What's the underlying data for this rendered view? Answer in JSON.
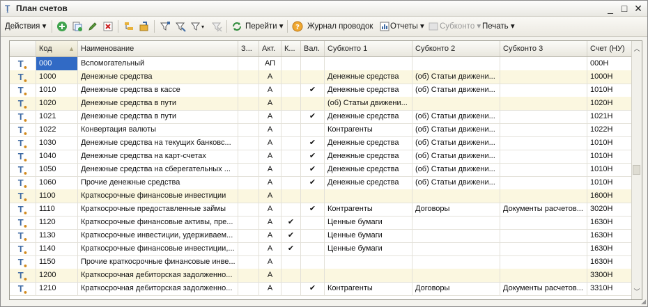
{
  "window": {
    "title": "План счетов"
  },
  "window_controls": {
    "minimize": "_",
    "maximize": "□",
    "close": "✕"
  },
  "toolbar": {
    "actions": "Действия",
    "goto": "Перейти",
    "journal": "Журнал проводок",
    "reports": "Отчеты",
    "subconto": "Субконто",
    "print": "Печать"
  },
  "columns": {
    "code": "Код",
    "name": "Наименование",
    "z": "З...",
    "act": "Акт.",
    "k": "К...",
    "val": "Вал.",
    "sub1": "Субконто 1",
    "sub2": "Субконто 2",
    "sub3": "Субконто 3",
    "nu": "Счет (НУ)"
  },
  "rows": [
    {
      "code": "000",
      "name": "Вспомогательный",
      "z": "",
      "act": "АП",
      "k": "",
      "val": "",
      "sub1": "",
      "sub2": "",
      "sub3": "",
      "nu": "000Н",
      "grp": false
    },
    {
      "code": "1000",
      "name": "Денежные средства",
      "z": "",
      "act": "А",
      "k": "",
      "val": "",
      "sub1": "Денежные средства",
      "sub2": "(об) Статьи движени...",
      "sub3": "",
      "nu": "1000Н",
      "grp": true
    },
    {
      "code": "1010",
      "name": "Денежные средства в кассе",
      "z": "",
      "act": "А",
      "k": "",
      "val": "✔",
      "sub1": "Денежные средства",
      "sub2": "(об) Статьи движени...",
      "sub3": "",
      "nu": "1010Н",
      "grp": false
    },
    {
      "code": "1020",
      "name": "Денежные средства в пути",
      "z": "",
      "act": "А",
      "k": "",
      "val": "",
      "sub1": "(об) Статьи движени...",
      "sub2": "",
      "sub3": "",
      "nu": "1020Н",
      "grp": true
    },
    {
      "code": "1021",
      "name": "Денежные средства в пути",
      "z": "",
      "act": "А",
      "k": "",
      "val": "✔",
      "sub1": "Денежные средства",
      "sub2": "(об) Статьи движени...",
      "sub3": "",
      "nu": "1021Н",
      "grp": false
    },
    {
      "code": "1022",
      "name": "Конвертация валюты",
      "z": "",
      "act": "А",
      "k": "",
      "val": "",
      "sub1": "Контрагенты",
      "sub2": "(об) Статьи движени...",
      "sub3": "",
      "nu": "1022Н",
      "grp": false
    },
    {
      "code": "1030",
      "name": "Денежные средства на текущих банковс...",
      "z": "",
      "act": "А",
      "k": "",
      "val": "✔",
      "sub1": "Денежные средства",
      "sub2": "(об) Статьи движени...",
      "sub3": "",
      "nu": "1010Н",
      "grp": false
    },
    {
      "code": "1040",
      "name": "Денежные средства на карт-счетах",
      "z": "",
      "act": "А",
      "k": "",
      "val": "✔",
      "sub1": "Денежные средства",
      "sub2": "(об) Статьи движени...",
      "sub3": "",
      "nu": "1010Н",
      "grp": false
    },
    {
      "code": "1050",
      "name": "Денежные средства на сберегательных ...",
      "z": "",
      "act": "А",
      "k": "",
      "val": "✔",
      "sub1": "Денежные средства",
      "sub2": "(об) Статьи движени...",
      "sub3": "",
      "nu": "1010Н",
      "grp": false
    },
    {
      "code": "1060",
      "name": "Прочие денежные средства",
      "z": "",
      "act": "А",
      "k": "",
      "val": "✔",
      "sub1": "Денежные средства",
      "sub2": "(об) Статьи движени...",
      "sub3": "",
      "nu": "1010Н",
      "grp": false
    },
    {
      "code": "1100",
      "name": "Краткосрочные финансовые инвестиции",
      "z": "",
      "act": "А",
      "k": "",
      "val": "",
      "sub1": "",
      "sub2": "",
      "sub3": "",
      "nu": "1600Н",
      "grp": true
    },
    {
      "code": "1110",
      "name": "Краткосрочные предоставленные займы",
      "z": "",
      "act": "А",
      "k": "",
      "val": "✔",
      "sub1": "Контрагенты",
      "sub2": "Договоры",
      "sub3": "Документы расчетов...",
      "nu": "3020Н",
      "grp": false
    },
    {
      "code": "1120",
      "name": "Краткосрочные финансовые активы, пре...",
      "z": "",
      "act": "А",
      "k": "✔",
      "val": "",
      "sub1": "Ценные бумаги",
      "sub2": "",
      "sub3": "",
      "nu": "1630Н",
      "grp": false
    },
    {
      "code": "1130",
      "name": "Краткосрочные инвестиции, удерживаем...",
      "z": "",
      "act": "А",
      "k": "✔",
      "val": "",
      "sub1": "Ценные бумаги",
      "sub2": "",
      "sub3": "",
      "nu": "1630Н",
      "grp": false
    },
    {
      "code": "1140",
      "name": "Краткосрочные финансовые инвестиции,...",
      "z": "",
      "act": "А",
      "k": "✔",
      "val": "",
      "sub1": "Ценные бумаги",
      "sub2": "",
      "sub3": "",
      "nu": "1630Н",
      "grp": false
    },
    {
      "code": "1150",
      "name": "Прочие краткосрочные финансовые инве...",
      "z": "",
      "act": "А",
      "k": "",
      "val": "",
      "sub1": "",
      "sub2": "",
      "sub3": "",
      "nu": "1630Н",
      "grp": false
    },
    {
      "code": "1200",
      "name": "Краткосрочная дебиторская задолженно...",
      "z": "",
      "act": "А",
      "k": "",
      "val": "",
      "sub1": "",
      "sub2": "",
      "sub3": "",
      "nu": "3300Н",
      "grp": true
    },
    {
      "code": "1210",
      "name": "Краткосрочная дебиторская задолженно...",
      "z": "",
      "act": "А",
      "k": "",
      "val": "✔",
      "sub1": "Контрагенты",
      "sub2": "Договоры",
      "sub3": "Документы расчетов...",
      "nu": "3310Н",
      "grp": false
    }
  ],
  "colors": {
    "selection": "#316ac5",
    "group_row": "#fbf7e0",
    "type_icon": "#3e6aa3"
  }
}
